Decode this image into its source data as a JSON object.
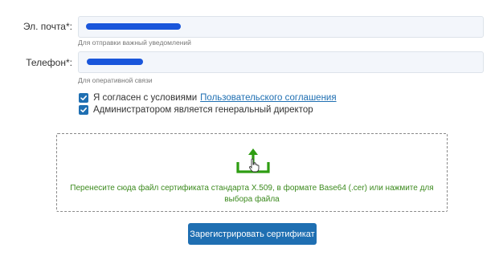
{
  "form": {
    "email": {
      "label": "Эл. почта*:",
      "value": "",
      "hint": "Для отправки важный уведомлений"
    },
    "phone": {
      "label": "Телефон*:",
      "value": "",
      "hint": "Для оперативной связи"
    },
    "checkboxes": {
      "agree_text": "Я согласен с условиями",
      "agree_link": "Пользовательского соглашения",
      "agree_checked": true,
      "admin_text": "Администратором является генеральный директор",
      "admin_checked": true
    },
    "dropzone": {
      "text": "Перенесите сюда файл сертификата стандарта X.509, в формате Base64 (.cer) или нажмите для выбора файла",
      "icon": "upload-icon"
    },
    "submit_label": "Зарегистрировать сертификат"
  },
  "colors": {
    "accent": "#1f6fb2",
    "dropzone_text": "#3c8a1e",
    "upload_icon": "#2e9d12",
    "input_bg": "#f3f6fb"
  }
}
